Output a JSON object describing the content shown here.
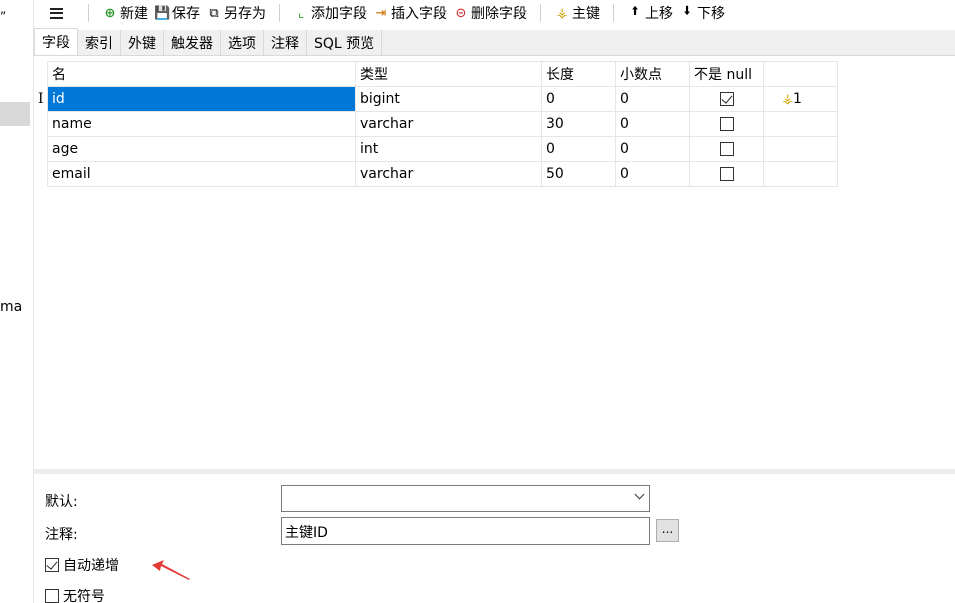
{
  "left_panel": {
    "fragment_text": "ma"
  },
  "toolbar": {
    "new_label": "新建",
    "save_label": "保存",
    "save_as_label": "另存为",
    "add_field_label": "添加字段",
    "insert_field_label": "插入字段",
    "delete_field_label": "删除字段",
    "primary_key_label": "主键",
    "move_up_label": "上移",
    "move_down_label": "下移"
  },
  "tabs": [
    {
      "label": "字段",
      "active": true
    },
    {
      "label": "索引"
    },
    {
      "label": "外键"
    },
    {
      "label": "触发器"
    },
    {
      "label": "选项"
    },
    {
      "label": "注释"
    },
    {
      "label": "SQL 预览"
    }
  ],
  "grid": {
    "headers": [
      "名",
      "类型",
      "长度",
      "小数点",
      "不是 null",
      ""
    ],
    "rows": [
      {
        "name": "id",
        "type": "bigint",
        "length": "0",
        "decimals": "0",
        "not_null": true,
        "key": "1"
      },
      {
        "name": "name",
        "type": "varchar",
        "length": "30",
        "decimals": "0",
        "not_null": false,
        "key": ""
      },
      {
        "name": "age",
        "type": "int",
        "length": "0",
        "decimals": "0",
        "not_null": false,
        "key": ""
      },
      {
        "name": "email",
        "type": "varchar",
        "length": "50",
        "decimals": "0",
        "not_null": false,
        "key": ""
      }
    ]
  },
  "properties": {
    "default_label": "默认:",
    "default_value": "",
    "comment_label": "注释:",
    "comment_value": "主键ID",
    "browse_label": "...",
    "auto_increment_label": "自动递增",
    "auto_increment_checked": true,
    "unsigned_label": "无符号",
    "unsigned_checked": false
  },
  "colors": {
    "selection": "#0078d7",
    "annotation_arrow": "#e53935",
    "key_icon": "#d4a800"
  },
  "icons": [
    "menu-icon",
    "new-icon",
    "save-icon",
    "save-as-icon",
    "add-field-icon",
    "insert-field-icon",
    "delete-field-icon",
    "key-icon",
    "arrow-up-icon",
    "arrow-down-icon"
  ]
}
